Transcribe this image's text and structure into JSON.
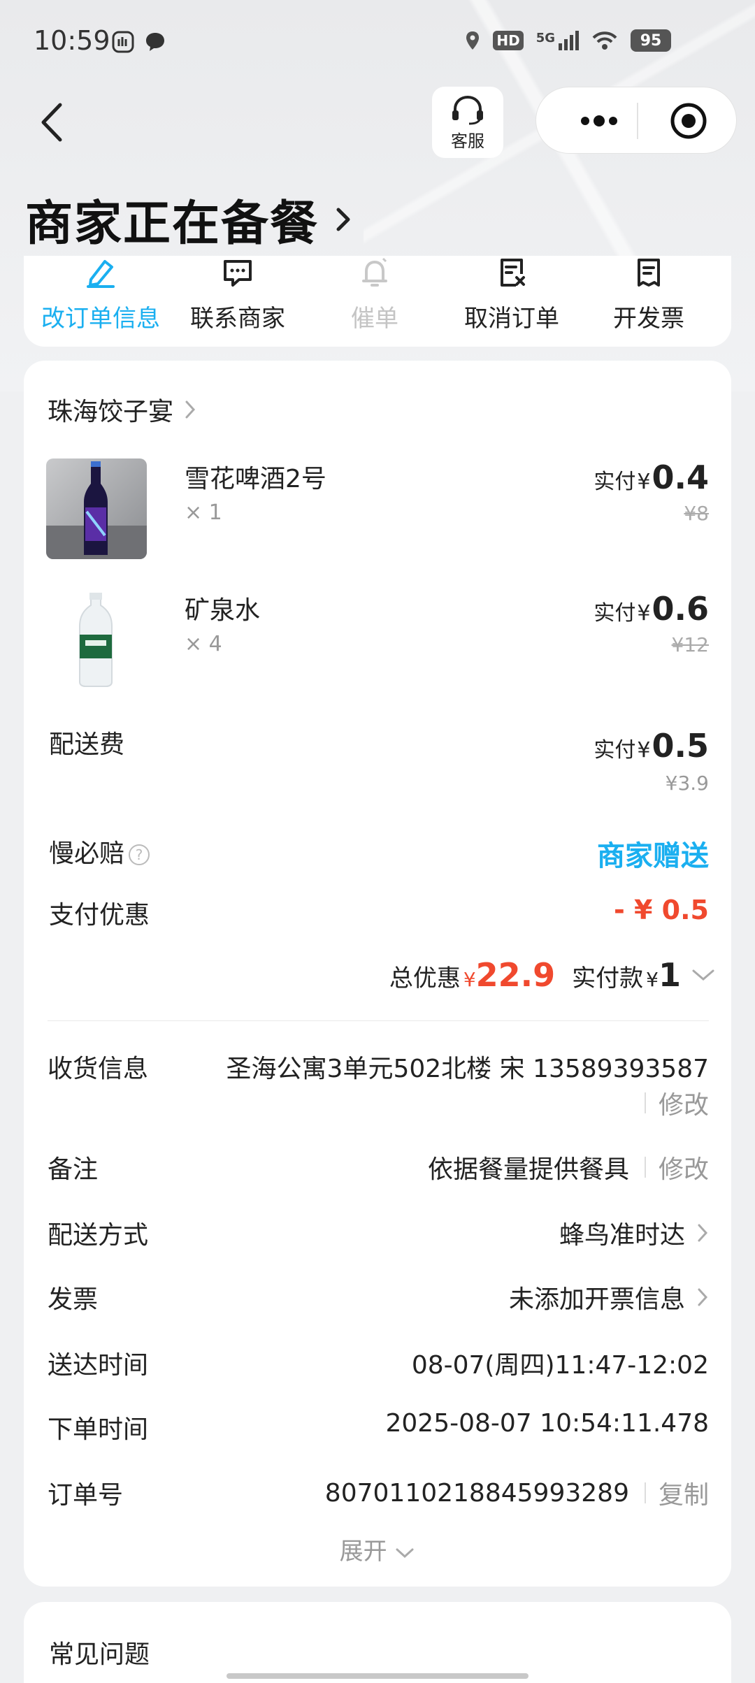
{
  "status_bar": {
    "time": "10:59",
    "network": "5G",
    "hd": "HD",
    "battery": "95"
  },
  "header": {
    "service_label": "客服",
    "title": "商家正在备餐"
  },
  "actions": [
    {
      "label": "改订单信息",
      "icon": "edit-icon",
      "state": "active"
    },
    {
      "label": "联系商家",
      "icon": "chat-icon",
      "state": "normal"
    },
    {
      "label": "催单",
      "icon": "bell-icon",
      "state": "disabled"
    },
    {
      "label": "取消订单",
      "icon": "cancel-doc-icon",
      "state": "normal"
    },
    {
      "label": "开发票",
      "icon": "invoice-icon",
      "state": "normal"
    }
  ],
  "order": {
    "shop_name": "珠海饺子宴",
    "items": [
      {
        "name": "雪花啤酒2号",
        "qty": "× 1",
        "paid_label": "实付",
        "currency": "¥",
        "paid": "0.4",
        "original": "¥8"
      },
      {
        "name": "矿泉水",
        "qty": "× 4",
        "paid_label": "实付",
        "currency": "¥",
        "paid": "0.6",
        "original": "¥12"
      }
    ],
    "delivery_fee": {
      "label": "配送费",
      "paid_label": "实付",
      "currency": "¥",
      "paid": "0.5",
      "original": "¥3.9"
    },
    "slow_compensation": {
      "label": "慢必赔",
      "value": "商家赠送"
    },
    "payment_discount": {
      "label": "支付优惠",
      "value": "- ¥ 0.5"
    },
    "totals": {
      "discount_label": "总优惠",
      "currency": "¥",
      "discount": "22.9",
      "paid_label": "实付款",
      "paid": "1"
    }
  },
  "info": {
    "address": {
      "label": "收货信息",
      "value": "圣海公寓3单元502北楼 宋 13589393587",
      "action": "修改"
    },
    "remark": {
      "label": "备注",
      "value": "依据餐量提供餐具",
      "action": "修改"
    },
    "delivery_method": {
      "label": "配送方式",
      "value": "蜂鸟准时达"
    },
    "invoice": {
      "label": "发票",
      "value": "未添加开票信息"
    },
    "delivery_time": {
      "label": "送达时间",
      "value": "08-07(周四)11:47-12:02"
    },
    "order_time": {
      "label": "下单时间",
      "value": "2025-08-07 10:54:11.478"
    },
    "order_no": {
      "label": "订单号",
      "value": "8070110218845993289",
      "action": "复制"
    },
    "expand_label": "展开"
  },
  "faq": {
    "title": "常见问题"
  },
  "colors": {
    "accent_blue": "#1aaff0",
    "price_red": "#f0492e"
  }
}
